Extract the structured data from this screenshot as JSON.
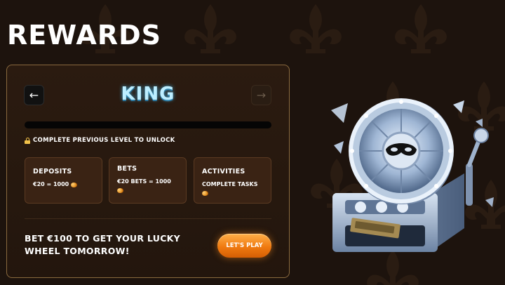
{
  "page": {
    "title": "REWARDS"
  },
  "level": {
    "name": "KING",
    "prev_icon": "←",
    "next_icon": "→",
    "progress_fraction": 0,
    "locked_message": "COMPLETE PREVIOUS LEVEL TO UNLOCK",
    "lock_icon": "lock-icon"
  },
  "tiles": [
    {
      "title": "DEPOSITS",
      "value": "€20 = 1000",
      "icon": "coin-icon"
    },
    {
      "title": "BETS",
      "value": "€20 BETS = 1000",
      "icon": "coin-icon"
    },
    {
      "title": "ACTIVITIES",
      "value": "COMPLETE TASKS",
      "icon": "coin-icon"
    }
  ],
  "promo": {
    "text": "BET €100 TO GET YOUR LUCKY WHEEL TOMORROW!",
    "cta_label": "LET'S PLAY"
  },
  "colors": {
    "background": "#1d130d",
    "card_border": "#8a6a3e",
    "level_name": "#bdeeff",
    "cta": "#f07a10"
  }
}
